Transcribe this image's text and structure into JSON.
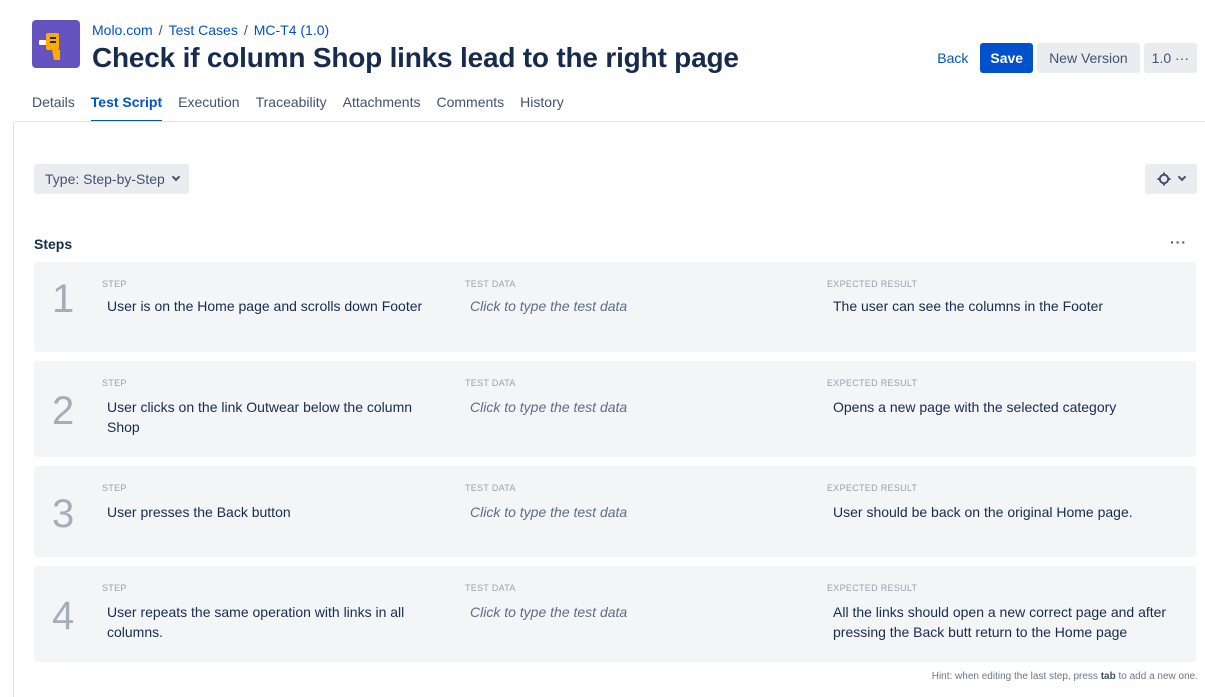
{
  "breadcrumb": {
    "project": "Molo.com",
    "section": "Test Cases",
    "case": "MC-T4 (1.0)",
    "separator": "/"
  },
  "title": "Check if column Shop links lead to the right page",
  "actions": {
    "back": "Back",
    "save": "Save",
    "new_version": "New Version",
    "version": "1.0 ···"
  },
  "tabs": [
    {
      "label": "Details",
      "active": false
    },
    {
      "label": "Test Script",
      "active": true
    },
    {
      "label": "Execution",
      "active": false
    },
    {
      "label": "Traceability",
      "active": false
    },
    {
      "label": "Attachments",
      "active": false
    },
    {
      "label": "Comments",
      "active": false
    },
    {
      "label": "History",
      "active": false
    }
  ],
  "type_select": {
    "label": "Type: Step-by-Step"
  },
  "steps_section": {
    "title": "Steps",
    "more": "···"
  },
  "column_labels": {
    "step": "STEP",
    "test_data": "TEST DATA",
    "expected": "EXPECTED RESULT"
  },
  "steps": [
    {
      "number": "1",
      "step": "User is on the Home page and scrolls down Footer",
      "test_data": "Click to type the test data",
      "expected": "The user can see the columns in the Footer"
    },
    {
      "number": "2",
      "step": "User clicks on the link Outwear below the column Shop",
      "test_data": "Click to type the test data",
      "expected": "Opens a new page with the selected category"
    },
    {
      "number": "3",
      "step": "User presses the Back button",
      "test_data": "Click to type the test data",
      "expected": "User should be back on the original Home page."
    },
    {
      "number": "4",
      "step": "User repeats the same operation with links in all columns.",
      "test_data": "Click to type the test data",
      "expected": "All the links should open a new correct page and after pressing the Back butt return to the Home page"
    }
  ],
  "hint": {
    "prefix": "Hint: when editing the last step, press",
    "key": "tab",
    "suffix": "to add a new one."
  },
  "colors": {
    "accent": "#0052cc",
    "project_icon": "#6554c0",
    "row_bg": "#f4f5f7"
  }
}
